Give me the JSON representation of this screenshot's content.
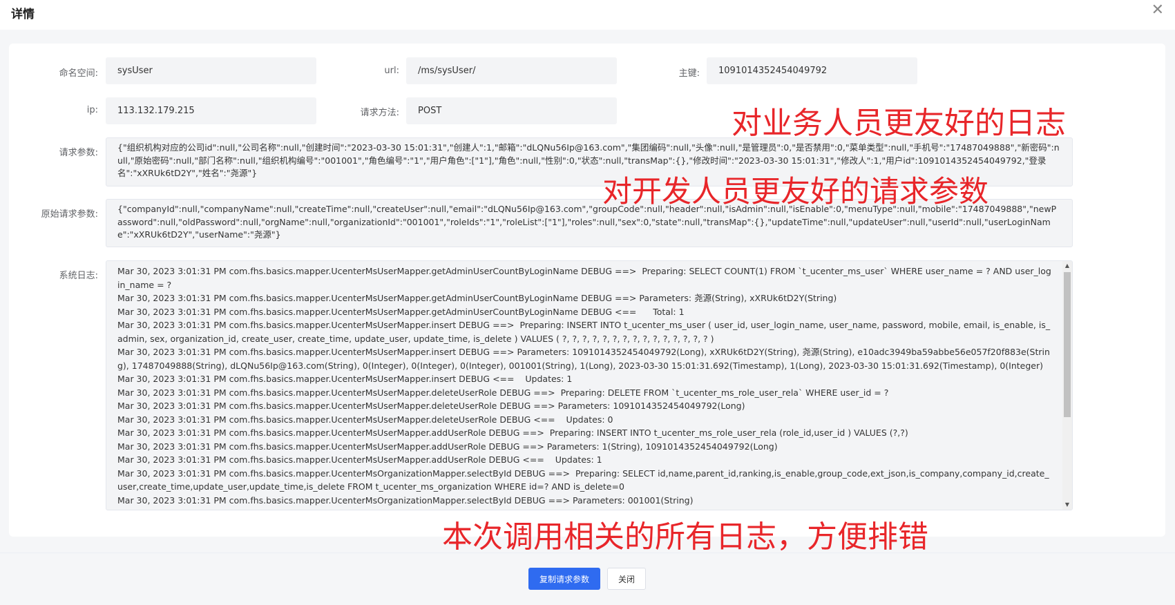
{
  "dialog": {
    "title": "详情",
    "close_icon": "close-icon"
  },
  "form": {
    "namespace": {
      "label": "命名空间:",
      "value": "sysUser"
    },
    "url": {
      "label": "url:",
      "value": "/ms/sysUser/"
    },
    "primary_key": {
      "label": "主键:",
      "value": "1091014352454049792"
    },
    "ip": {
      "label": "ip:",
      "value": "113.132.179.215"
    },
    "method": {
      "label": "请求方法:",
      "value": "POST"
    },
    "request_params": {
      "label": "请求参数:",
      "value": "{\"组织机构对应的公司id\":null,\"公司名称\":null,\"创建时间\":\"2023-03-30 15:01:31\",\"创建人\":1,\"邮箱\":\"dLQNu56Ip@163.com\",\"集团编码\":null,\"头像\":null,\"是管理员\":0,\"是否禁用\":0,\"菜单类型\":null,\"手机号\":\"17487049888\",\"新密码\":null,\"原始密码\":null,\"部门名称\":null,\"组织机构编号\":\"001001\",\"角色编号\":\"1\",\"用户角色\":[\"1\"],\"角色\":null,\"性别\":0,\"状态\":null,\"transMap\":{},\"修改时间\":\"2023-03-30 15:01:31\",\"修改人\":1,\"用户id\":1091014352454049792,\"登录名\":\"xXRUk6tD2Y\",\"姓名\":\"尧源\"}"
    },
    "raw_params": {
      "label": "原始请求参数:",
      "value": "{\"companyId\":null,\"companyName\":null,\"createTime\":null,\"createUser\":null,\"email\":\"dLQNu56Ip@163.com\",\"groupCode\":null,\"header\":null,\"isAdmin\":null,\"isEnable\":0,\"menuType\":null,\"mobile\":\"17487049888\",\"newPassword\":null,\"oldPassword\":null,\"orgName\":null,\"organizationId\":\"001001\",\"roleIds\":\"1\",\"roleList\":[\"1\"],\"roles\":null,\"sex\":0,\"state\":null,\"transMap\":{},\"updateTime\":null,\"updateUser\":null,\"userId\":null,\"userLoginName\":\"xXRUk6tD2Y\",\"userName\":\"尧源\"}"
    },
    "system_log": {
      "label": "系统日志:",
      "lines": [
        "Mar 30, 2023 3:01:31 PM com.fhs.basics.mapper.UcenterMsUserMapper.getAdminUserCountByLoginName DEBUG ==>  Preparing: SELECT COUNT(1) FROM `t_ucenter_ms_user` WHERE user_name = ? AND user_login_name = ?",
        "Mar 30, 2023 3:01:31 PM com.fhs.basics.mapper.UcenterMsUserMapper.getAdminUserCountByLoginName DEBUG ==> Parameters: 尧源(String), xXRUk6tD2Y(String)",
        "Mar 30, 2023 3:01:31 PM com.fhs.basics.mapper.UcenterMsUserMapper.getAdminUserCountByLoginName DEBUG <==      Total: 1",
        "Mar 30, 2023 3:01:31 PM com.fhs.basics.mapper.UcenterMsUserMapper.insert DEBUG ==>  Preparing: INSERT INTO t_ucenter_ms_user ( user_id, user_login_name, user_name, password, mobile, email, is_enable, is_admin, sex, organization_id, create_user, create_time, update_user, update_time, is_delete ) VALUES ( ?, ?, ?, ?, ?, ?, ?, ?, ?, ?, ?, ?, ?, ?, ? )",
        "Mar 30, 2023 3:01:31 PM com.fhs.basics.mapper.UcenterMsUserMapper.insert DEBUG ==> Parameters: 1091014352454049792(Long), xXRUk6tD2Y(String), 尧源(String), e10adc3949ba59abbe56e057f20f883e(String), 17487049888(String), dLQNu56Ip@163.com(String), 0(Integer), 0(Integer), 0(Integer), 001001(String), 1(Long), 2023-03-30 15:01:31.692(Timestamp), 1(Long), 2023-03-30 15:01:31.692(Timestamp), 0(Integer)",
        "Mar 30, 2023 3:01:31 PM com.fhs.basics.mapper.UcenterMsUserMapper.insert DEBUG <==    Updates: 1",
        "Mar 30, 2023 3:01:31 PM com.fhs.basics.mapper.UcenterMsUserMapper.deleteUserRole DEBUG ==>  Preparing: DELETE FROM `t_ucenter_ms_role_user_rela` WHERE user_id = ?",
        "Mar 30, 2023 3:01:31 PM com.fhs.basics.mapper.UcenterMsUserMapper.deleteUserRole DEBUG ==> Parameters: 1091014352454049792(Long)",
        "Mar 30, 2023 3:01:31 PM com.fhs.basics.mapper.UcenterMsUserMapper.deleteUserRole DEBUG <==    Updates: 0",
        "Mar 30, 2023 3:01:31 PM com.fhs.basics.mapper.UcenterMsUserMapper.addUserRole DEBUG ==>  Preparing: INSERT INTO t_ucenter_ms_role_user_rela (role_id,user_id ) VALUES (?,?)",
        "Mar 30, 2023 3:01:31 PM com.fhs.basics.mapper.UcenterMsUserMapper.addUserRole DEBUG ==> Parameters: 1(String), 1091014352454049792(Long)",
        "Mar 30, 2023 3:01:31 PM com.fhs.basics.mapper.UcenterMsUserMapper.addUserRole DEBUG <==    Updates: 1",
        "Mar 30, 2023 3:01:31 PM com.fhs.basics.mapper.UcenterMsOrganizationMapper.selectById DEBUG ==>  Preparing: SELECT id,name,parent_id,ranking,is_enable,group_code,ext_json,is_company,company_id,create_user,create_time,update_user,update_time,is_delete FROM t_ucenter_ms_organization WHERE id=? AND is_delete=0",
        "Mar 30, 2023 3:01:31 PM com.fhs.basics.mapper.UcenterMsOrganizationMapper.selectById DEBUG ==> Parameters: 001001(String)"
      ]
    }
  },
  "annotations": {
    "business": "对业务人员更友好的日志",
    "developer": "对开发人员更友好的请求参数",
    "logs": "本次调用相关的所有日志，方便排错"
  },
  "footer": {
    "copy_button": "复制请求参数",
    "close_button": "关闭"
  },
  "colors": {
    "primary": "#2f6bf0",
    "annotation": "#e8262a"
  }
}
